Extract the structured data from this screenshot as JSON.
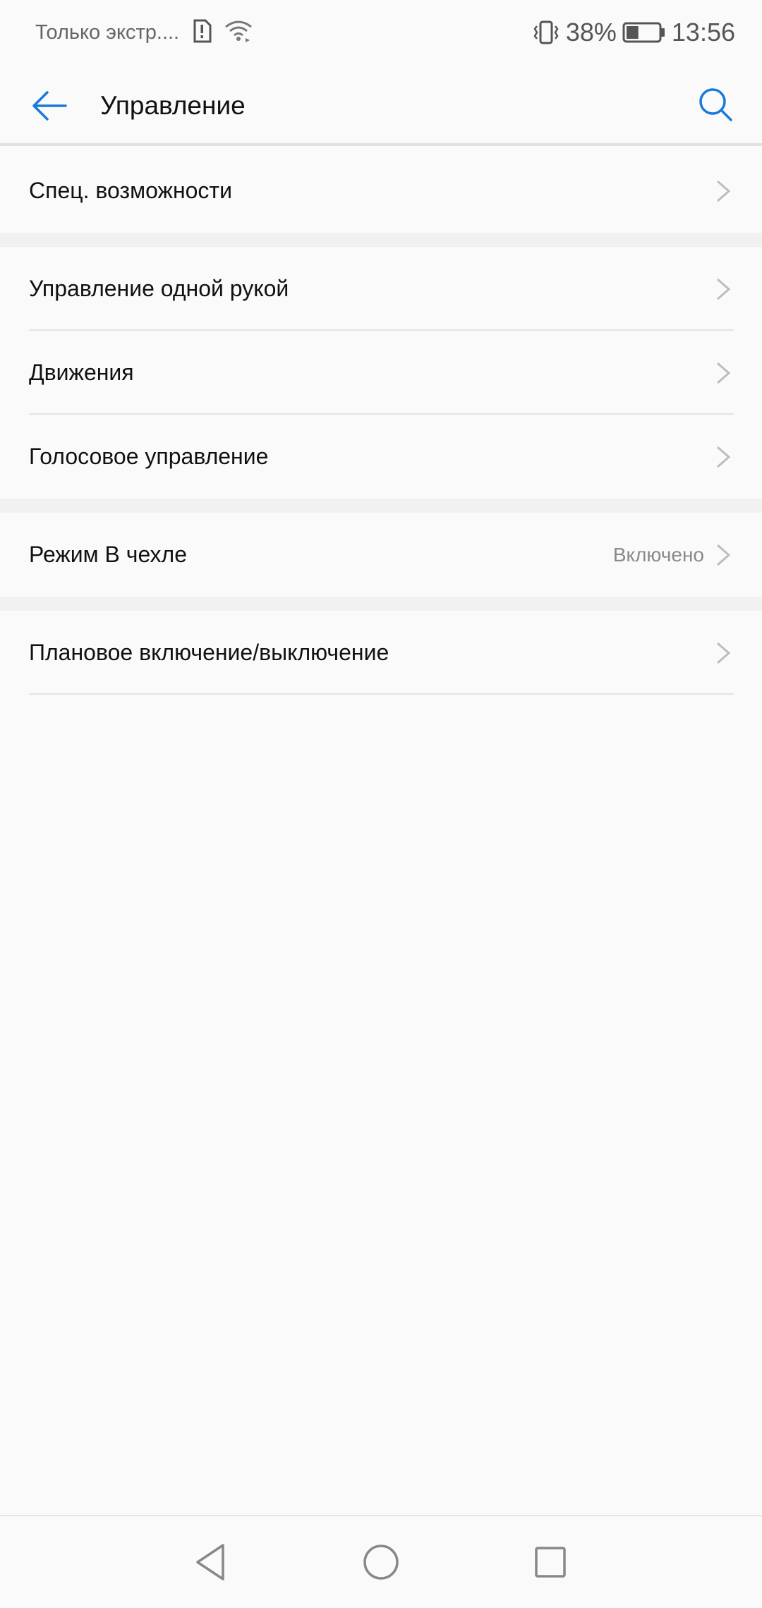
{
  "status_bar": {
    "carrier": "Только экстр....",
    "battery_percent": "38%",
    "battery_level": 0.38,
    "time": "13:56",
    "icons": [
      "sim-alert-icon",
      "wifi-icon",
      "vibrate-icon",
      "battery-icon"
    ]
  },
  "app_bar": {
    "title": "Управление",
    "back_icon": "arrow-left-icon",
    "search_icon": "search-icon",
    "accent_color": "#1a7ad9"
  },
  "list": {
    "group1": {
      "items": [
        {
          "label": "Спец. возможности",
          "value": ""
        }
      ]
    },
    "group2": {
      "items": [
        {
          "label": "Управление одной рукой",
          "value": ""
        },
        {
          "label": "Движения",
          "value": ""
        },
        {
          "label": "Голосовое управление",
          "value": ""
        }
      ]
    },
    "group3": {
      "items": [
        {
          "label": "Режим В чехле",
          "value": "Включено"
        }
      ]
    },
    "group4": {
      "items": [
        {
          "label": "Плановое включение/выключение",
          "value": ""
        }
      ]
    }
  },
  "nav_bar": {
    "icons": [
      "back-triangle-icon",
      "home-circle-icon",
      "recents-square-icon"
    ]
  }
}
